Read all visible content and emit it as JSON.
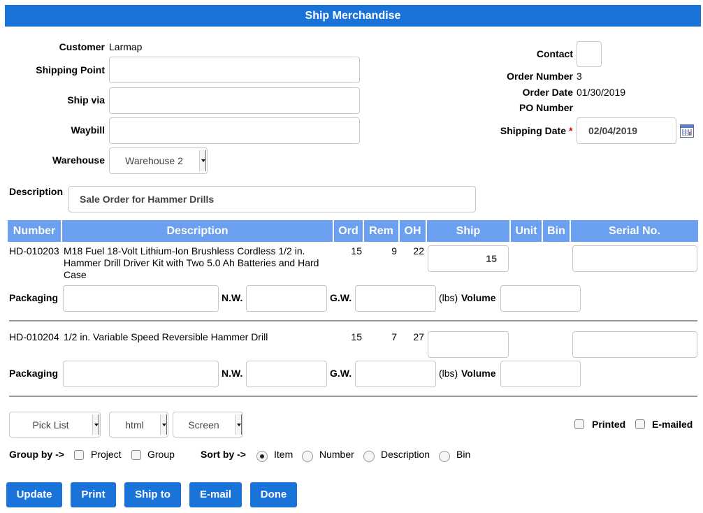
{
  "header": {
    "title": "Ship Merchandise"
  },
  "form": {
    "customer_label": "Customer",
    "customer_value": "Larmap",
    "shipping_point_label": "Shipping Point",
    "shipping_point_value": "",
    "ship_via_label": "Ship via",
    "ship_via_value": "",
    "waybill_label": "Waybill",
    "waybill_value": "",
    "warehouse_label": "Warehouse",
    "warehouse_value": "Warehouse 2",
    "description_label": "Description",
    "description_value": "Sale Order for Hammer Drills",
    "contact_label": "Contact",
    "contact_value": "",
    "order_number_label": "Order Number",
    "order_number_value": "3",
    "order_date_label": "Order Date",
    "order_date_value": "01/30/2019",
    "po_number_label": "PO Number",
    "po_number_value": "",
    "shipping_date_label": "Shipping Date",
    "required_mark": "*",
    "shipping_date_value": "02/04/2019"
  },
  "table": {
    "columns": [
      "Number",
      "Description",
      "Ord",
      "Rem",
      "OH",
      "Ship",
      "Unit",
      "Bin",
      "Serial No."
    ],
    "rows": [
      {
        "number": "HD-010203",
        "description": "M18 Fuel 18-Volt Lithium-Ion Brushless Cordless 1/2 in. Hammer Drill Driver Kit with Two 5.0 Ah Batteries and Hard Case",
        "ord": "15",
        "rem": "9",
        "oh": "22",
        "ship": "15",
        "unit": "",
        "bin": "",
        "serial": "",
        "packaging": "",
        "nw": "",
        "gw": "",
        "volume": ""
      },
      {
        "number": "HD-010204",
        "description": "1/2 in. Variable Speed Reversible Hammer Drill",
        "ord": "15",
        "rem": "7",
        "oh": "27",
        "ship": "",
        "unit": "",
        "bin": "",
        "serial": "",
        "packaging": "",
        "nw": "",
        "gw": "",
        "volume": ""
      }
    ],
    "packaging_label": "Packaging",
    "nw_label": "N.W.",
    "gw_label": "G.W.",
    "lbs_label": "(lbs)",
    "volume_label": "Volume"
  },
  "options": {
    "form_select": "Pick List",
    "format_select": "html",
    "media_select": "Screen",
    "printed_label": "Printed",
    "emailed_label": "E-mailed",
    "group_by_label": "Group by ->",
    "group_project_label": "Project",
    "group_group_label": "Group",
    "sort_by_label": "Sort by ->",
    "sort_item_label": "Item",
    "sort_number_label": "Number",
    "sort_description_label": "Description",
    "sort_bin_label": "Bin",
    "sort_selected": "Item"
  },
  "buttons": {
    "update": "Update",
    "print": "Print",
    "ship_to": "Ship to",
    "email": "E-mail",
    "done": "Done"
  },
  "colors": {
    "title_bar": "#1a73d9",
    "table_header": "#6b9ff0",
    "button": "#1a73d9",
    "required": "#d00000"
  },
  "icons": {
    "calendar": "calendar-icon"
  }
}
